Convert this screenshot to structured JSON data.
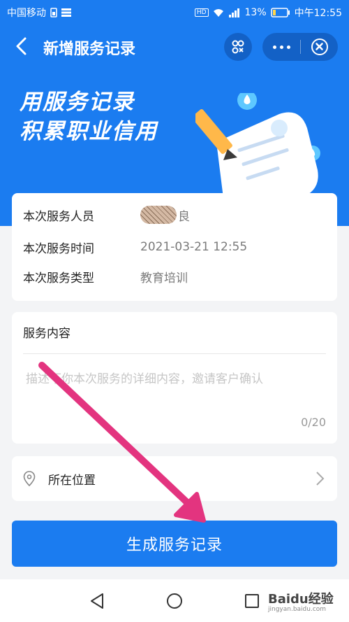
{
  "status_bar": {
    "carrier": "中国移动",
    "network": "HD",
    "battery_percent": "13%",
    "time": "中午12:55"
  },
  "header": {
    "title": "新增服务记录",
    "slogan_line1": "用服务记录",
    "slogan_line2": "积累职业信用"
  },
  "info": {
    "rows": [
      {
        "label": "本次服务人员",
        "value": "良"
      },
      {
        "label": "本次服务时间",
        "value": "2021-03-21 12:55"
      },
      {
        "label": "本次服务类型",
        "value": "教育培训"
      }
    ]
  },
  "content": {
    "label": "服务内容",
    "placeholder": "描述下你本次服务的详细内容，邀请客户确认",
    "counter": "0/20"
  },
  "location": {
    "label": "所在位置"
  },
  "submit_label": "生成服务记录",
  "watermark": {
    "brand": "Baidu经验",
    "url": "jingyan.baidu.com"
  },
  "colors": {
    "primary": "#1b7cf0",
    "annotation_arrow": "#e3347f"
  }
}
